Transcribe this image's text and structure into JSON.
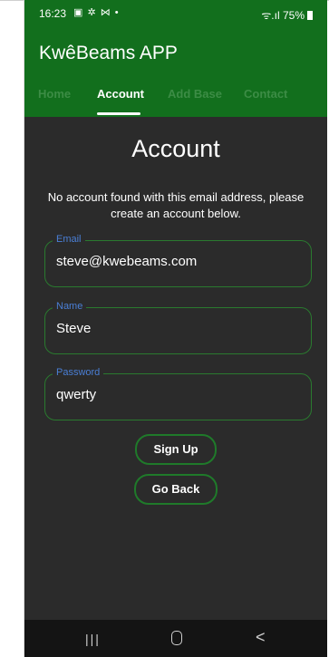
{
  "status_bar": {
    "time": "16:23",
    "notification_icons": "▣ ✲ ⋈ •",
    "signal_text": "ᯤ.ıl",
    "battery": "75%"
  },
  "app": {
    "title": "KwêBeams APP"
  },
  "tabs": [
    {
      "label": "Home",
      "active": false
    },
    {
      "label": "Account",
      "active": true
    },
    {
      "label": "Add Base",
      "active": false
    },
    {
      "label": "Contact",
      "active": false
    }
  ],
  "page": {
    "heading": "Account",
    "message": "No account found with this email address, please create an account below."
  },
  "form": {
    "email": {
      "label": "Email",
      "value": "steve@kwebeams.com"
    },
    "name": {
      "label": "Name",
      "value": "Steve"
    },
    "password": {
      "label": "Password",
      "value": "qwerty"
    }
  },
  "buttons": {
    "sign_up": "Sign Up",
    "go_back": "Go Back"
  },
  "nav_bar": {
    "recents": "|||",
    "back": "<"
  },
  "colors": {
    "primary_green": "#126f1d",
    "background": "#2b2b2b",
    "label_blue": "#4a7fd6",
    "border_green": "#2a7a2f"
  }
}
